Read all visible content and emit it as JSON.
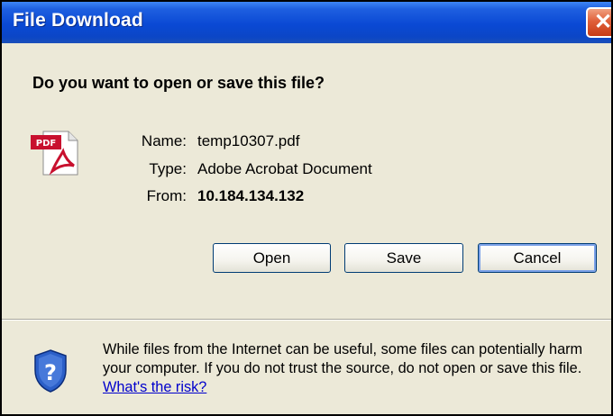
{
  "window": {
    "title": "File Download"
  },
  "dialog": {
    "question": "Do you want to open or save this file?",
    "file_icon": "pdf-file-icon",
    "file_icon_text": "PDF",
    "fields": {
      "name_label": "Name:",
      "name_value": "temp10307.pdf",
      "type_label": "Type:",
      "type_value": "Adobe Acrobat Document",
      "from_label": "From:",
      "from_value": "10.184.134.132"
    },
    "buttons": {
      "open": "Open",
      "save": "Save",
      "cancel": "Cancel"
    },
    "warning": {
      "icon": "shield-question-icon",
      "text": "While files from the Internet can be useful, some files can potentially harm your computer. If you do not trust the source, do not open or save this file.",
      "link": "What's the risk?"
    }
  },
  "colors": {
    "titlebar": "#0a49d4",
    "body": "#ece9d8",
    "link": "#0000cc",
    "close": "#e0603a"
  }
}
